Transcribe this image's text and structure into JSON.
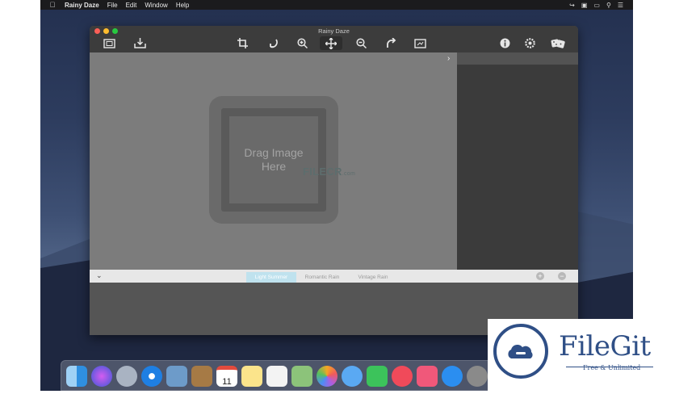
{
  "menubar": {
    "apple": "",
    "app_name": "Rainy Daze",
    "items": [
      "File",
      "Edit",
      "Window",
      "Help"
    ]
  },
  "window": {
    "title": "Rainy Daze"
  },
  "toolbar": {
    "icons": [
      "export-image-icon",
      "import-icon",
      "crop-icon",
      "rotate-left-icon",
      "zoom-in-icon",
      "move-icon",
      "zoom-out-icon",
      "redo-icon",
      "fit-image-icon",
      "info-icon",
      "settings-icon",
      "random-dice-icon"
    ]
  },
  "canvas": {
    "drop_text_line1": "Drag Image",
    "drop_text_line2": "Here",
    "watermark": "FILECR",
    "watermark_suffix": ".com"
  },
  "presets": {
    "items": [
      "Light Summer",
      "Romantic Rain",
      "Vintage Rain"
    ],
    "selected_index": 0,
    "add_label": "+",
    "remove_label": "−"
  },
  "badge": {
    "name": "FileGit",
    "tagline": "Free & Unlimited"
  },
  "dock": {
    "calendar_day": "11"
  },
  "colors": {
    "brand": "#2f4f86",
    "canvas": "#7c7c7c",
    "sidebar": "#3b3b3b",
    "preset_selected": "#bfe2ee"
  }
}
